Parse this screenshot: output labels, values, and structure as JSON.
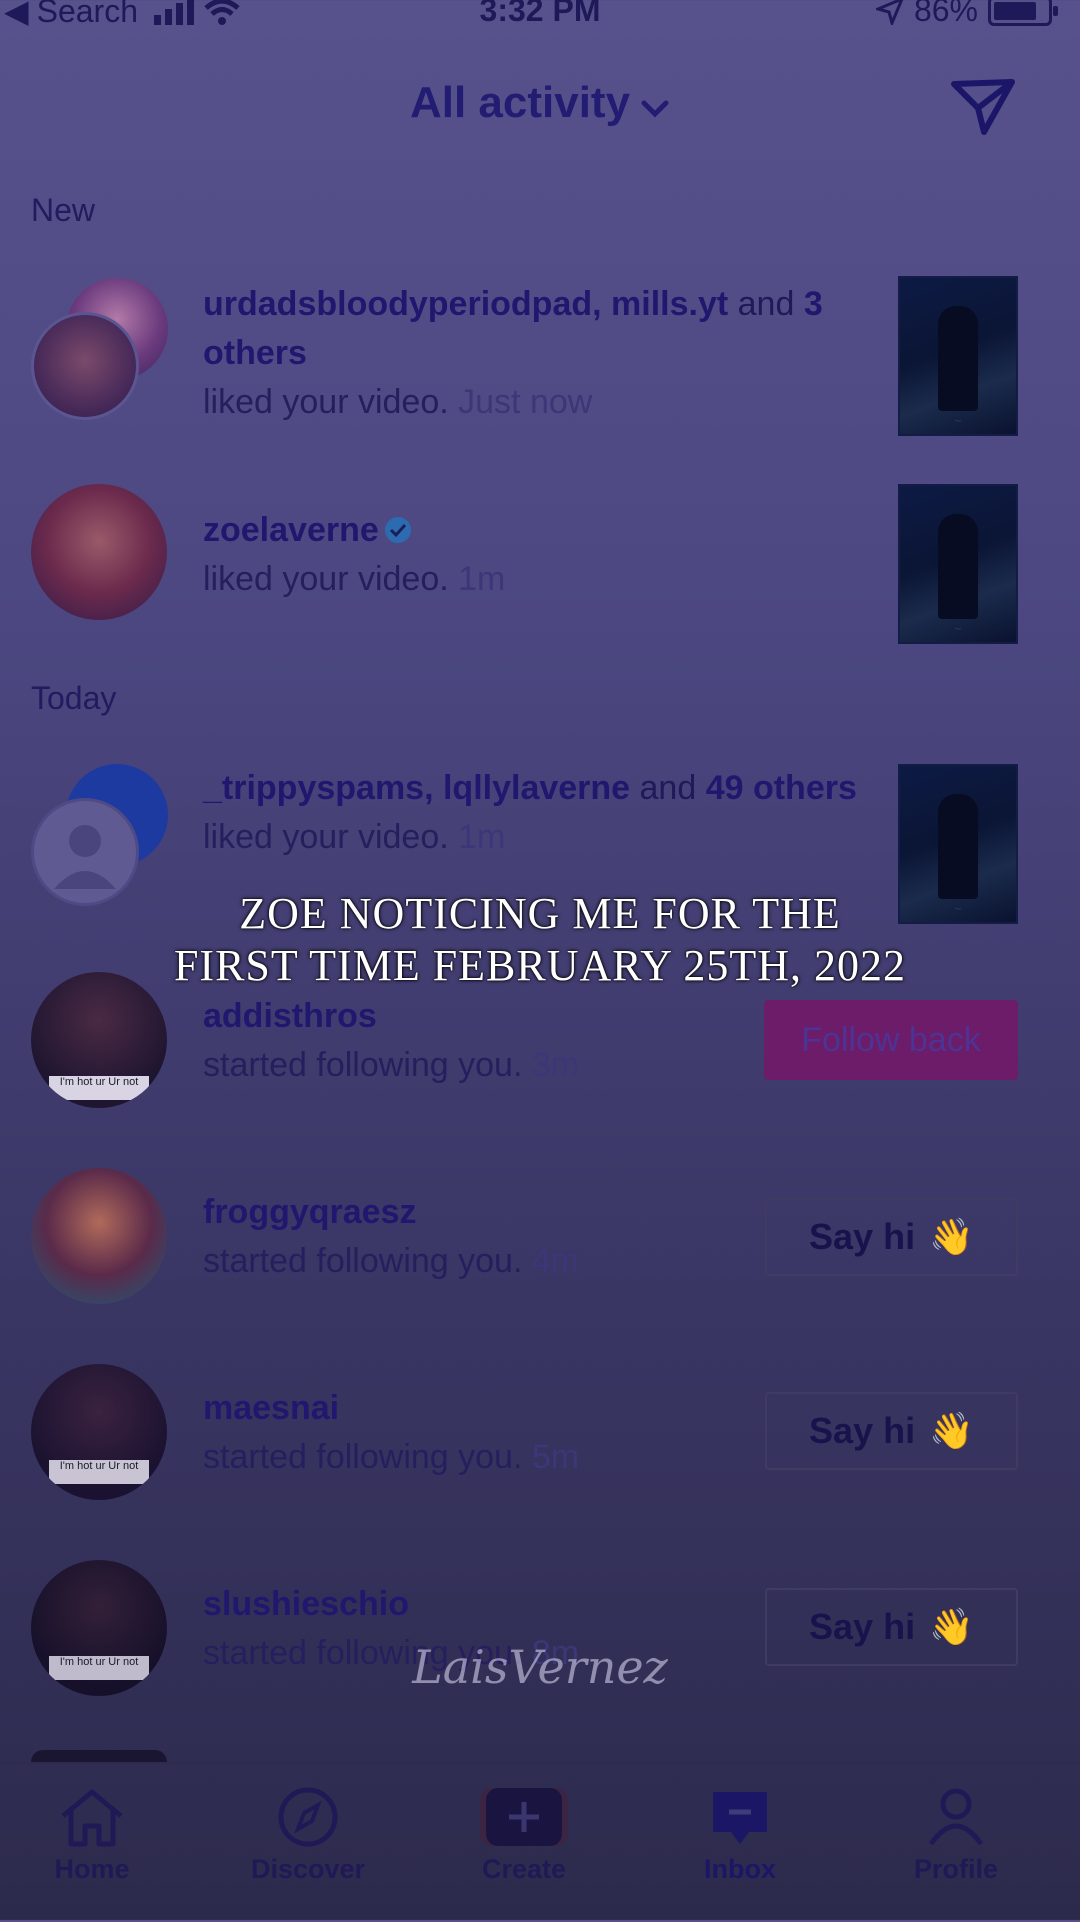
{
  "status": {
    "back_label": "Search",
    "time": "3:32 PM",
    "battery": "86%"
  },
  "header": {
    "title": "All activity"
  },
  "sections": {
    "new": "New",
    "today": "Today"
  },
  "notifications": [
    {
      "names": "urdadsbloodyperiodpad, mills.yt",
      "and": " and ",
      "count": "3 others",
      "action": "liked your video.",
      "time": "Just now"
    },
    {
      "names": "zoelaverne",
      "action": "liked your video.",
      "time": "1m"
    },
    {
      "names": "_trippyspams, lqllylaverne",
      "and": " and ",
      "count": "49 others",
      "action": "liked your video.",
      "time": "1m"
    },
    {
      "names": "addisthros",
      "action": "started following you.",
      "time": "3m",
      "button": "Follow back",
      "avatar_text": "I'm hot ur Ur not"
    },
    {
      "names": "froggyqraesz",
      "action": "started following you.",
      "time": "4m",
      "button": "Say hi"
    },
    {
      "names": "maesnai",
      "action": "started following you.",
      "time": "5m",
      "button": "Say hi",
      "avatar_text": "I'm hot ur Ur not"
    },
    {
      "names": "slushieschio",
      "action": "started following you.",
      "time": "8m",
      "button": "Say hi",
      "avatar_text": "I'm hot ur Ur not"
    }
  ],
  "overlay": {
    "line1": "ZOE NOTICING ME FOR THE",
    "line2": "FIRST TIME FEBRUARY 25TH, 2022",
    "watermark": "LaisVernez"
  },
  "tabs": [
    {
      "label": "Home",
      "icon": "home-icon"
    },
    {
      "label": "Discover",
      "icon": "compass-icon"
    },
    {
      "label": "Create",
      "icon": "plus-icon"
    },
    {
      "label": "Inbox",
      "icon": "inbox-icon"
    },
    {
      "label": "Profile",
      "icon": "profile-icon"
    }
  ],
  "colors": {
    "accent": "#6d1c6a",
    "tint": "#4d4882",
    "text": "#201a5a"
  }
}
